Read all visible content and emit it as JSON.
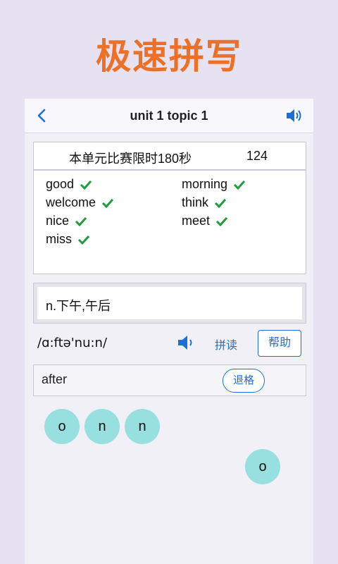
{
  "banner": "极速拼写",
  "header": {
    "title": "unit 1 topic 1"
  },
  "timer": {
    "label": "本单元比赛限时180秒",
    "value": "124"
  },
  "words": [
    {
      "text": "good"
    },
    {
      "text": "morning"
    },
    {
      "text": "welcome"
    },
    {
      "text": "think"
    },
    {
      "text": "nice"
    },
    {
      "text": "meet"
    },
    {
      "text": "miss"
    }
  ],
  "meaning": "n.下午,午后",
  "phonetic": "/ɑ:ftə'nu:n/",
  "controls": {
    "spell": "拼读",
    "help": "帮助",
    "backspace": "退格"
  },
  "answer": "after",
  "tiles": [
    "o",
    "n",
    "n",
    "o"
  ],
  "colors": {
    "accent": "#1d6fd4",
    "banner": "#ee7026",
    "check": "#1f9d3a",
    "tile": "#98dfe0"
  }
}
